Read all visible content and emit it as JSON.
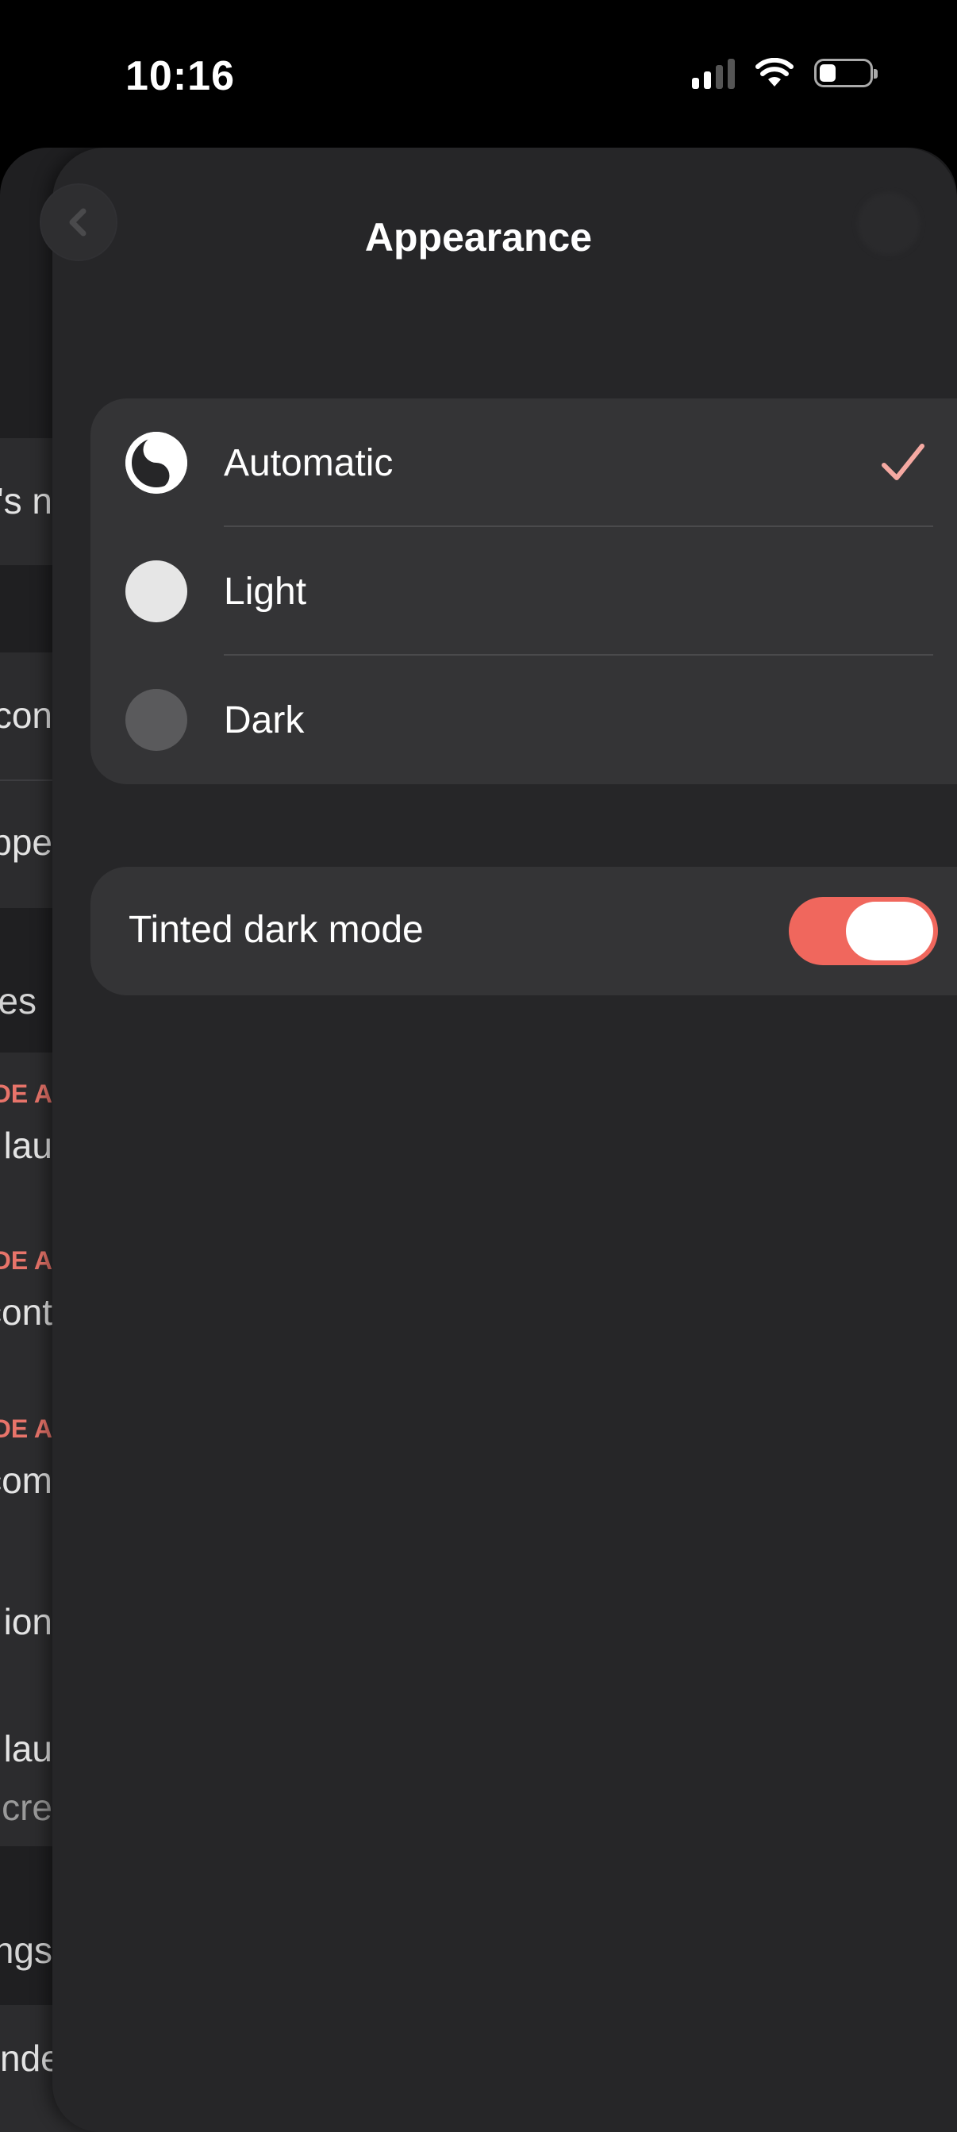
{
  "status_bar": {
    "time": "10:16"
  },
  "header": {
    "title": "Appearance"
  },
  "appearance_options": [
    {
      "label": "Automatic",
      "selected": true,
      "icon": "auto-theme-icon"
    },
    {
      "label": "Light",
      "selected": false,
      "icon": "light-theme-icon"
    },
    {
      "label": "Dark",
      "selected": false,
      "icon": "dark-theme-icon"
    }
  ],
  "tinted_dark_mode": {
    "label": "Tinted dark mode",
    "enabled": true
  },
  "background_fragments": [
    "'s n",
    "con",
    "ppe",
    "es",
    "DE A",
    "al lau",
    "DE A",
    "cont",
    "DE A",
    "com",
    "ion",
    "l lau",
    "cre",
    "ngs",
    "nder rescu"
  ],
  "colors": {
    "accent": "#f0675d",
    "sheet": "#262628",
    "group": "#343436",
    "check": "#f5a9a2"
  }
}
